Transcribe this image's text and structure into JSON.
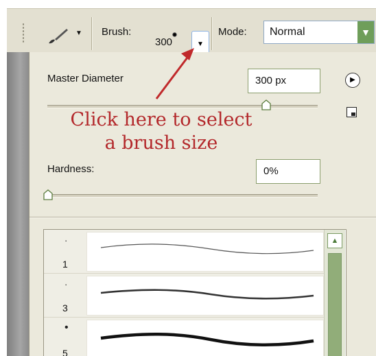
{
  "options_bar": {
    "brush_label": "Brush:",
    "brush_size": "300",
    "mode_label": "Mode:",
    "mode_value": "Normal"
  },
  "panel": {
    "master_diameter_label": "Master Diameter",
    "master_diameter_value": "300 px",
    "hardness_label": "Hardness:",
    "hardness_value": "0%",
    "diameter_slider_fraction": 0.77,
    "hardness_slider_fraction": 0.0
  },
  "annotation": {
    "line1": "Click here to select",
    "line2": "a brush size",
    "color": "#b3282b"
  },
  "presets": [
    {
      "size": "1",
      "dot": "·"
    },
    {
      "size": "3",
      "dot": "·"
    },
    {
      "size": "5",
      "dot": "•"
    }
  ],
  "icons": {
    "tool": "brush-icon",
    "panel_menu": "flyout-arrow-icon",
    "new_preset": "new-preset-icon",
    "scroll_up": "chevron-up-icon"
  }
}
